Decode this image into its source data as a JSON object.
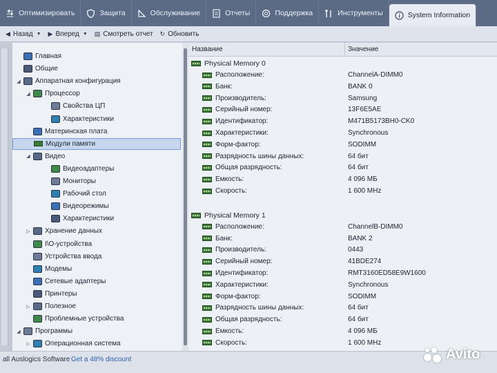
{
  "tabs": [
    {
      "label": "Оптимизировать",
      "icon": "sliders-icon"
    },
    {
      "label": "Защита",
      "icon": "shield-icon"
    },
    {
      "label": "Обслуживание",
      "icon": "maintenance-icon"
    },
    {
      "label": "Отчеты",
      "icon": "report-icon"
    },
    {
      "label": "Поддержка",
      "icon": "lifebuoy-icon"
    },
    {
      "label": "Инструменты",
      "icon": "tools-icon"
    },
    {
      "label": "System Information",
      "icon": "info-icon",
      "active": true
    }
  ],
  "toolbar": {
    "back": "Назад",
    "forward": "Вперед",
    "view_report": "Смотреть отчет",
    "refresh": "Обновить"
  },
  "tree": [
    {
      "label": "Главная",
      "level": 1
    },
    {
      "label": "Общие",
      "level": 1
    },
    {
      "label": "Аппаратная конфигурация",
      "level": 1,
      "expanded": true
    },
    {
      "label": "Процессор",
      "level": 2,
      "expanded": true
    },
    {
      "label": "Свойства ЦП",
      "level": 3
    },
    {
      "label": "Характеристики",
      "level": 3
    },
    {
      "label": "Материнская плата",
      "level": 2
    },
    {
      "label": "Модули памяти",
      "level": 2,
      "selected": true
    },
    {
      "label": "Видео",
      "level": 2,
      "expanded": true
    },
    {
      "label": "Видеоадаптеры",
      "level": 3
    },
    {
      "label": "Мониторы",
      "level": 3
    },
    {
      "label": "Рабочий стол",
      "level": 3
    },
    {
      "label": "Видеорежимы",
      "level": 3
    },
    {
      "label": "Характеристики",
      "level": 3
    },
    {
      "label": "Хранение данных",
      "level": 2,
      "collapsed": true
    },
    {
      "label": "I\\O-устройства",
      "level": 2
    },
    {
      "label": "Устройства ввода",
      "level": 2
    },
    {
      "label": "Модемы",
      "level": 2
    },
    {
      "label": "Сетевые адаптеры",
      "level": 2
    },
    {
      "label": "Принтеры",
      "level": 2
    },
    {
      "label": "Полезное",
      "level": 2,
      "collapsed": true
    },
    {
      "label": "Проблемные устройства",
      "level": 2
    },
    {
      "label": "Программы",
      "level": 1,
      "expanded": true
    },
    {
      "label": "Операционная система",
      "level": 2,
      "collapsed": true
    }
  ],
  "columns": {
    "name": "Название",
    "value": "Значение"
  },
  "memory": [
    {
      "title": "Physical Memory 0",
      "props": [
        {
          "name": "Расположение:",
          "value": "ChannelA-DIMM0"
        },
        {
          "name": "Банк:",
          "value": "BANK 0"
        },
        {
          "name": "Производитель:",
          "value": "Samsung"
        },
        {
          "name": "Серийный номер:",
          "value": "13F6E5AE"
        },
        {
          "name": "Идентификатор:",
          "value": "M471B5173BH0-CK0"
        },
        {
          "name": "Характеристики:",
          "value": "Synchronous"
        },
        {
          "name": "Форм-фактор:",
          "value": "SODIMM"
        },
        {
          "name": "Разрядность шины данных:",
          "value": "64 бит"
        },
        {
          "name": "Общая разрядность:",
          "value": "64 бит"
        },
        {
          "name": "Емкость:",
          "value": "4 096 МБ"
        },
        {
          "name": "Скорость:",
          "value": "1 600 MHz"
        }
      ]
    },
    {
      "title": "Physical Memory 1",
      "props": [
        {
          "name": "Расположение:",
          "value": "ChannelB-DIMM0"
        },
        {
          "name": "Банк:",
          "value": "BANK 2"
        },
        {
          "name": "Производитель:",
          "value": "0443"
        },
        {
          "name": "Серийный номер:",
          "value": "41BDE274"
        },
        {
          "name": "Идентификатор:",
          "value": "RMT3160ED58E9W1600"
        },
        {
          "name": "Характеристики:",
          "value": "Synchronous"
        },
        {
          "name": "Форм-фактор:",
          "value": "SODIMM"
        },
        {
          "name": "Разрядность шины данных:",
          "value": "64 бит"
        },
        {
          "name": "Общая разрядность:",
          "value": "64 бит"
        },
        {
          "name": "Емкость:",
          "value": "4 096 МБ"
        },
        {
          "name": "Скорость:",
          "value": "1 600 MHz"
        }
      ]
    }
  ],
  "status": {
    "text": "all Auslogics Software",
    "link": "Get a 48% discount"
  },
  "watermark": "Avito",
  "colors": {
    "accent": "#2f5fb3",
    "tabbar": "#5b6b86",
    "selection": "#c5d6ee"
  }
}
